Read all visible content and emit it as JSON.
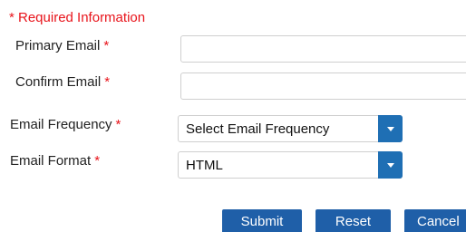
{
  "form": {
    "required_note": "* Required Information",
    "required_marker": "*",
    "fields": {
      "primary_email": {
        "label": "Primary Email",
        "value": "",
        "placeholder": ""
      },
      "confirm_email": {
        "label": "Confirm Email",
        "value": "",
        "placeholder": ""
      },
      "email_frequency": {
        "label": "Email Frequency",
        "selected": "Select Email Frequency"
      },
      "email_format": {
        "label": "Email Format",
        "selected": "HTML"
      }
    },
    "buttons": {
      "submit": "Submit",
      "reset": "Reset",
      "cancel": "Cancel"
    }
  },
  "colors": {
    "required_red": "#e8141b",
    "button_blue": "#1f5fa8",
    "select_arrow_blue": "#1f6fb4",
    "input_border": "#cfcfcf"
  },
  "icons": {
    "select_arrow": "chevron-down-icon"
  }
}
